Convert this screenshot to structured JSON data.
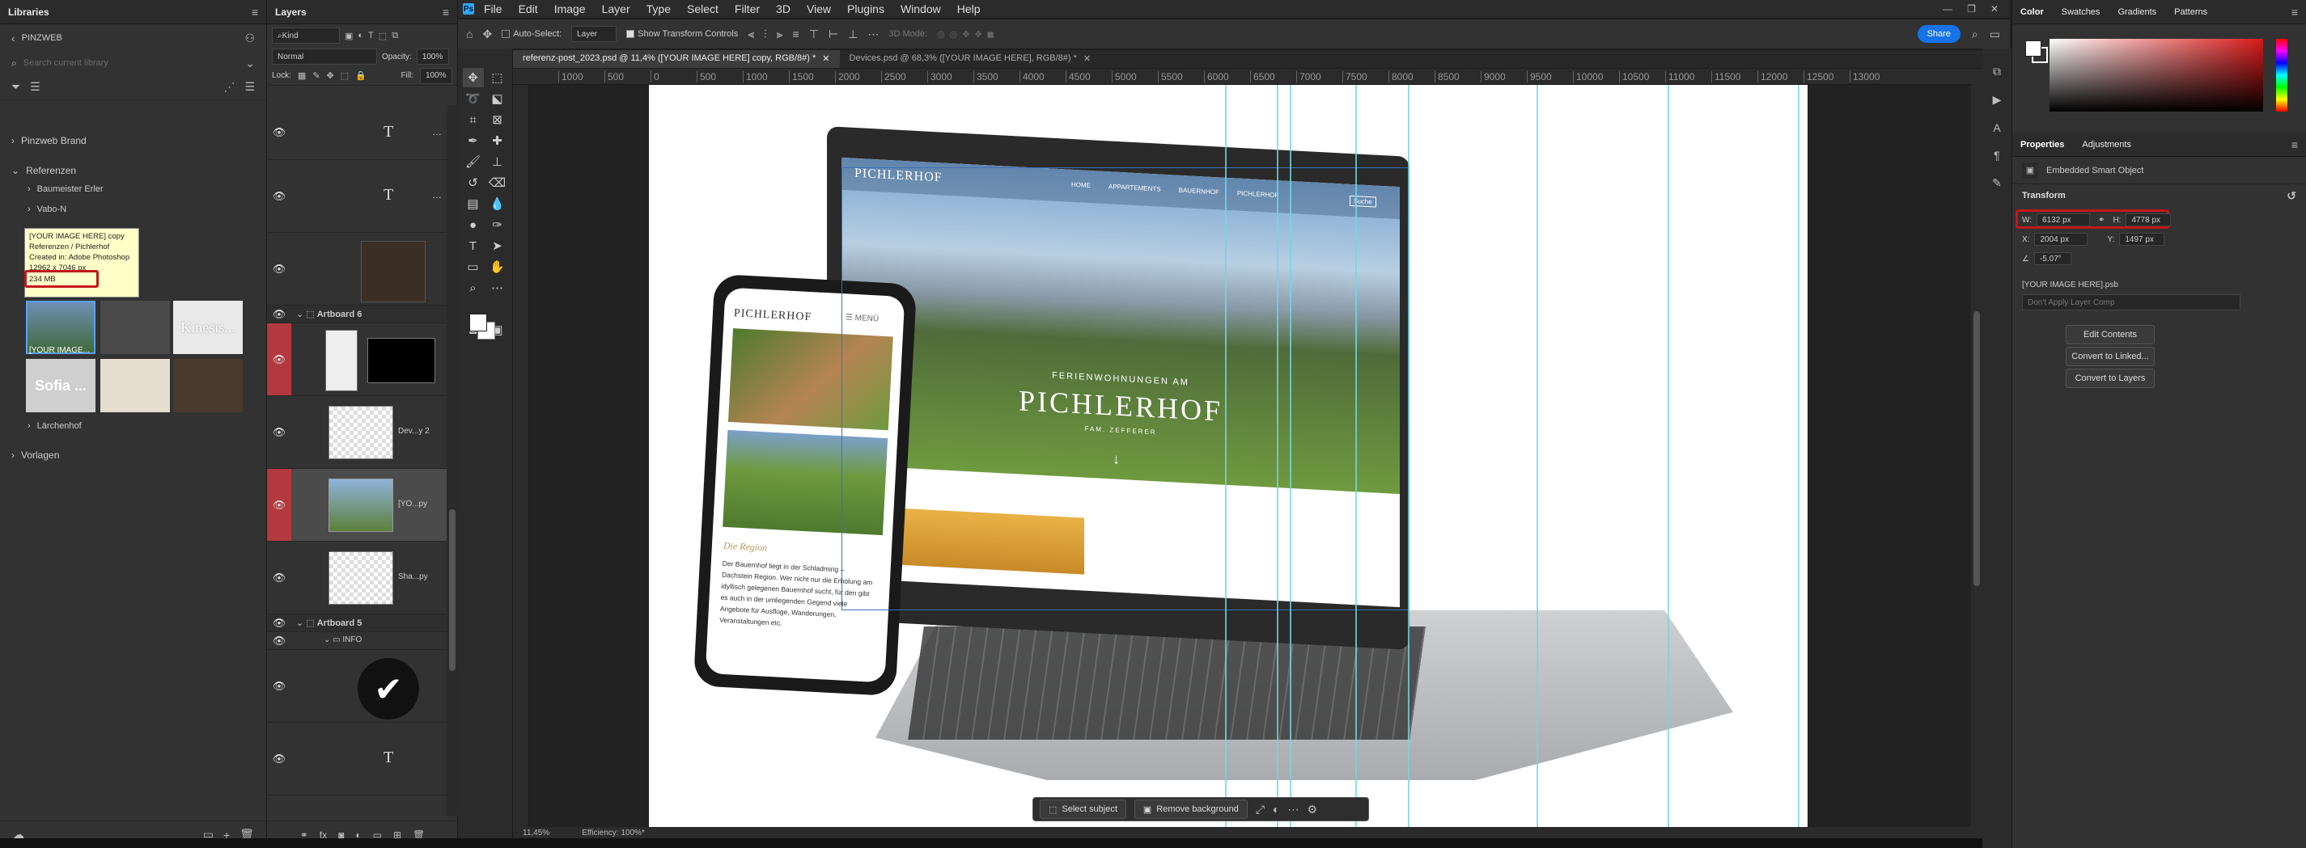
{
  "app": {
    "logo": "Ps",
    "menu": [
      "File",
      "Edit",
      "Image",
      "Layer",
      "Type",
      "Select",
      "Filter",
      "3D",
      "View",
      "Plugins",
      "Window",
      "Help"
    ]
  },
  "options_bar": {
    "auto_select_label": "Auto-Select:",
    "auto_select_value": "Layer",
    "show_transform_label": "Show Transform Controls",
    "mode_3d_label": "3D Mode:",
    "share_label": "Share"
  },
  "tabs": [
    {
      "label": "referenz-post_2023.psd @ 11,4% ([YOUR IMAGE HERE] copy, RGB/8#) *",
      "active": true
    },
    {
      "label": "Devices.psd @ 68,3% ([YOUR IMAGE HERE], RGB/8#) *",
      "active": false
    }
  ],
  "ruler": {
    "h_ticks": [
      "1000",
      "500",
      "0",
      "500",
      "1000",
      "1500",
      "2000",
      "2500",
      "3000",
      "3500",
      "4000",
      "4500",
      "5000",
      "5500",
      "6000",
      "6500",
      "7000",
      "7500",
      "8000",
      "8500",
      "9000",
      "9500",
      "10000",
      "10500",
      "11000",
      "11500",
      "12000",
      "12500",
      "13000"
    ]
  },
  "libraries": {
    "title": "Libraries",
    "library_name": "PINZWEB",
    "search_placeholder": "Search current library",
    "groups": [
      {
        "label": "Pinzweb Brand",
        "expanded": false
      },
      {
        "label": "Referenzen",
        "expanded": true
      }
    ],
    "subgroups": [
      "Baumeister Erler",
      "Vabo-N"
    ],
    "tooltip": {
      "line1": "[YOUR IMAGE HERE] copy",
      "line2": "Referenzen / Pichlerhof",
      "line3": "Created in: Adobe Photoshop",
      "line4": "12962 x 7046 px",
      "line5": "234 MB"
    },
    "thumb_labels": {
      "image": "[YOUR IMAGE...",
      "kinesis": "Kinesis...",
      "sofia": "Sofia ..."
    },
    "group_laerchenhof": "Lärchenhof",
    "group_vorlagen": "Vorlagen"
  },
  "layers": {
    "title": "Layers",
    "kind_label": "Kind",
    "blend_mode": "Normal",
    "opacity_label": "Opacity:",
    "opacity_value": "100%",
    "lock_label": "Lock:",
    "fill_label": "Fill:",
    "fill_value": "100%",
    "artboard6": "Artboard 6",
    "artboard5": "Artboard 5",
    "folder_info": "INFO",
    "layer_names": {
      "devices": "Dev...y 2",
      "your": "[YO...py",
      "shadow": "Sha...py"
    },
    "type_glyph": "T"
  },
  "canvas": {
    "zoom": "11,45%",
    "efficiency": "Efficiency: 100%*",
    "site": {
      "brand": "PICHLERHOF",
      "nav": [
        "HOME",
        "APPARTEMENTS",
        "BAUERNHOF",
        "PICHLERHOF"
      ],
      "search": "Suche",
      "hero_small": "FERIENWOHNUNGEN AM",
      "hero_big": "PICHLERHOF",
      "hero_sub": "FAM. ZEFFERER",
      "phone_brand": "PICHLERHOF",
      "phone_menu": "MENÜ",
      "phone_heading": "Die Region",
      "phone_text": "Der Bauernhof liegt in der Schladming – Dachstein Region. Wer nicht nur die Erholung am idyllisch gelegenen Bauernhof sucht, für den gibt es auch in der umliegenden Gegend viele Angebote für Ausflüge, Wanderungen, Veranstaltungen etc."
    }
  },
  "context_bar": {
    "select_subject": "Select subject",
    "remove_background": "Remove background"
  },
  "color_panel": {
    "tabs": [
      "Color",
      "Swatches",
      "Gradients",
      "Patterns"
    ],
    "accent": "#d91a1a"
  },
  "properties": {
    "tabs": [
      "Properties",
      "Adjustments"
    ],
    "type_label": "Embedded Smart Object",
    "transform_label": "Transform",
    "w_label": "W:",
    "w_value": "6132 px",
    "h_label": "H:",
    "h_value": "4778 px",
    "x_label": "X:",
    "x_value": "2004 px",
    "y_label": "Y:",
    "y_value": "1497 px",
    "angle_value": "-5.07°",
    "filename": "[YOUR IMAGE HERE].psb",
    "layer_comp": "Don't Apply Layer Comp",
    "edit_contents": "Edit Contents",
    "convert_linked": "Convert to Linked...",
    "convert_layers": "Convert to Layers"
  }
}
